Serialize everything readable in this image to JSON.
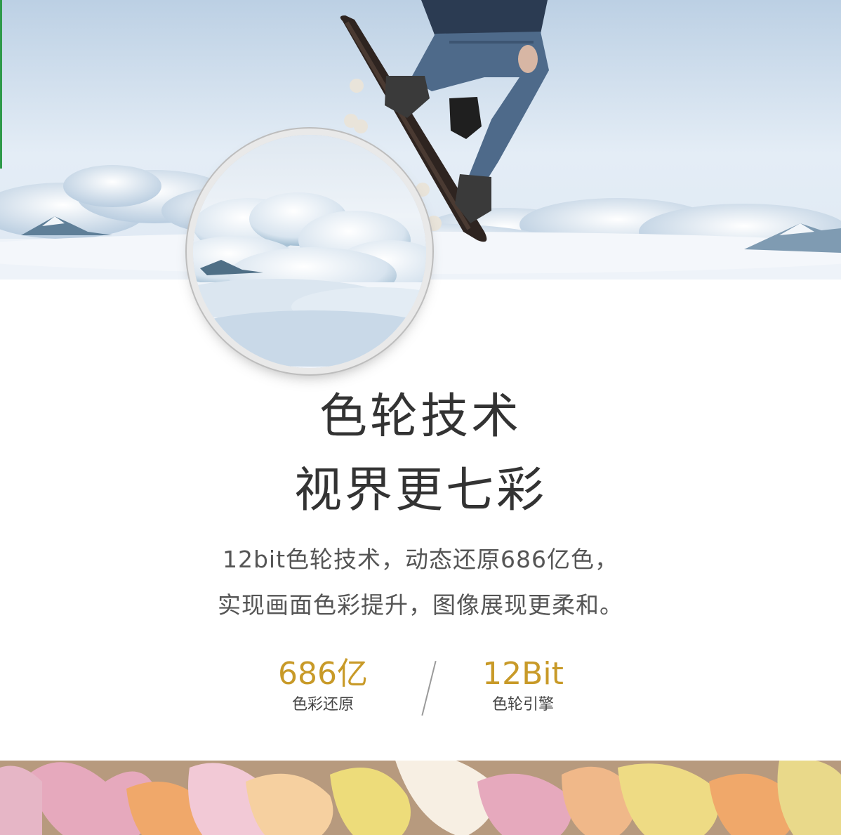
{
  "hero": {
    "image": "skateboarder-above-clouds-photo"
  },
  "lens": {
    "image": "magnified-cloud-detail"
  },
  "headline": {
    "line1": "色轮技术",
    "line2": "视界更七彩"
  },
  "description": {
    "line1": "12bit色轮技术，动态还原686亿色，",
    "line2": "实现画面色彩提升，图像展现更柔和。"
  },
  "stats": [
    {
      "value": "686亿",
      "label": "色彩还原"
    },
    {
      "value": "12Bit",
      "label": "色轮引擎"
    }
  ],
  "colors": {
    "accent": "#c89a28",
    "text": "#333333",
    "subtext": "#555555"
  },
  "candy_strip": {
    "image": "candy-hearts-photo"
  }
}
